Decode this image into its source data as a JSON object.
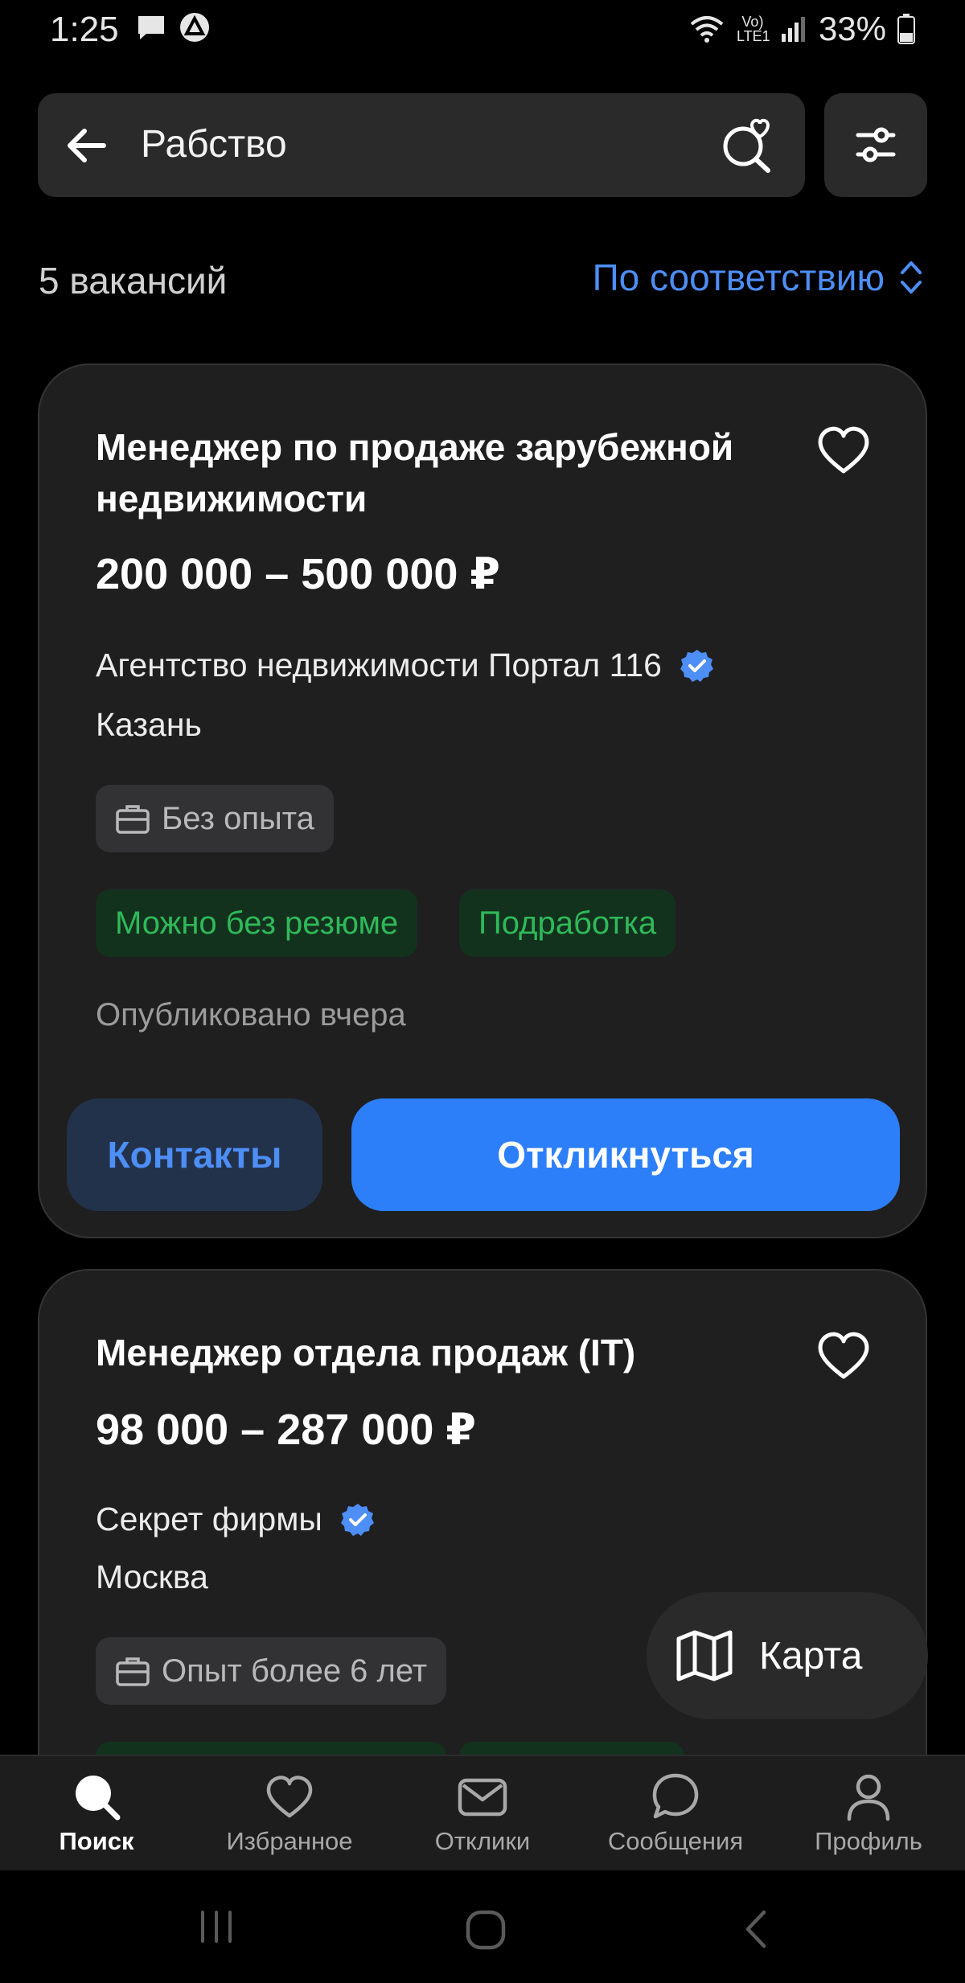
{
  "status_bar": {
    "time": "1:25",
    "network": "Vo) LTE1",
    "battery": "33%"
  },
  "search": {
    "query": "Рабство"
  },
  "results": {
    "count": "5 вакансий",
    "sort_label": "По соответствию"
  },
  "vacancies": [
    {
      "title": "Менеджер по продаже зарубежной недвижимости",
      "salary": "200 000 – 500 000 ₽",
      "company": "Агентство недвижимости Портал 116",
      "city": "Казань",
      "experience": "Без опыта",
      "tags": [
        "Можно без резюме",
        "Подработка"
      ],
      "published": "Опубликовано вчера",
      "contacts_label": "Контакты",
      "apply_label": "Откликнуться"
    },
    {
      "title": "Менеджер отдела продаж (IT)",
      "salary": "98 000 – 287 000 ₽",
      "company": "Секрет фирмы",
      "city": "Москва",
      "experience": "Опыт более 6 лет"
    }
  ],
  "map_button": {
    "label": "Карта"
  },
  "bottom_nav": [
    {
      "label": "Поиск",
      "icon": "search-icon",
      "active": true
    },
    {
      "label": "Избранное",
      "icon": "heart-icon"
    },
    {
      "label": "Отклики",
      "icon": "envelope-icon"
    },
    {
      "label": "Сообщения",
      "icon": "chat-bubble-icon"
    },
    {
      "label": "Профиль",
      "icon": "person-icon"
    }
  ],
  "colors": {
    "accent": "#2d7ff9",
    "link": "#4d8ef7",
    "tag_green": "#2fb95a",
    "card_bg": "#1f1f20"
  }
}
